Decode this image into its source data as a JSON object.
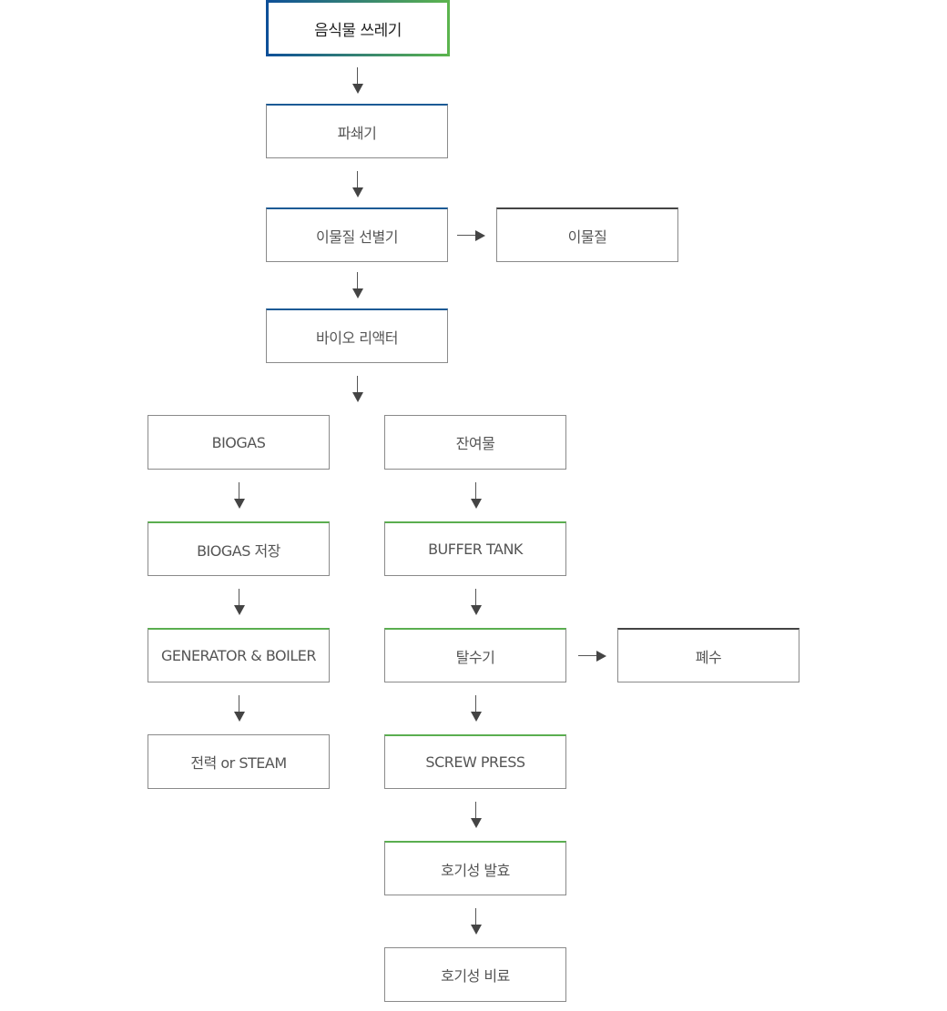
{
  "colors": {
    "accent_blue": "#1b5a95",
    "accent_green": "#5aae4f",
    "accent_dark": "#444444",
    "border": "#8a8a8a",
    "text": "#555555"
  },
  "nodes": {
    "food_waste": "음식물 쓰레기",
    "crusher": "파쇄기",
    "foreign_separator": "이물질 선별기",
    "foreign_matter": "이물질",
    "bio_reactor": "바이오 리액터",
    "biogas": "BIOGAS",
    "residue": "잔여물",
    "biogas_storage": "BIOGAS 저장",
    "buffer_tank": "BUFFER TANK",
    "generator_boiler": "GENERATOR & BOILER",
    "dehydrator": "탈수기",
    "wastewater": "폐수",
    "power_steam": "전력 or STEAM",
    "screw_press": "SCREW PRESS",
    "aerobic_fermentation": "호기성 발효",
    "aerobic_fertilizer": "호기성 비료"
  },
  "edges": [
    [
      "food_waste",
      "crusher"
    ],
    [
      "crusher",
      "foreign_separator"
    ],
    [
      "foreign_separator",
      "foreign_matter"
    ],
    [
      "foreign_separator",
      "bio_reactor"
    ],
    [
      "bio_reactor",
      "biogas"
    ],
    [
      "bio_reactor",
      "residue"
    ],
    [
      "biogas",
      "biogas_storage"
    ],
    [
      "biogas_storage",
      "generator_boiler"
    ],
    [
      "generator_boiler",
      "power_steam"
    ],
    [
      "residue",
      "buffer_tank"
    ],
    [
      "buffer_tank",
      "dehydrator"
    ],
    [
      "dehydrator",
      "wastewater"
    ],
    [
      "dehydrator",
      "screw_press"
    ],
    [
      "screw_press",
      "aerobic_fermentation"
    ],
    [
      "aerobic_fermentation",
      "aerobic_fertilizer"
    ]
  ]
}
